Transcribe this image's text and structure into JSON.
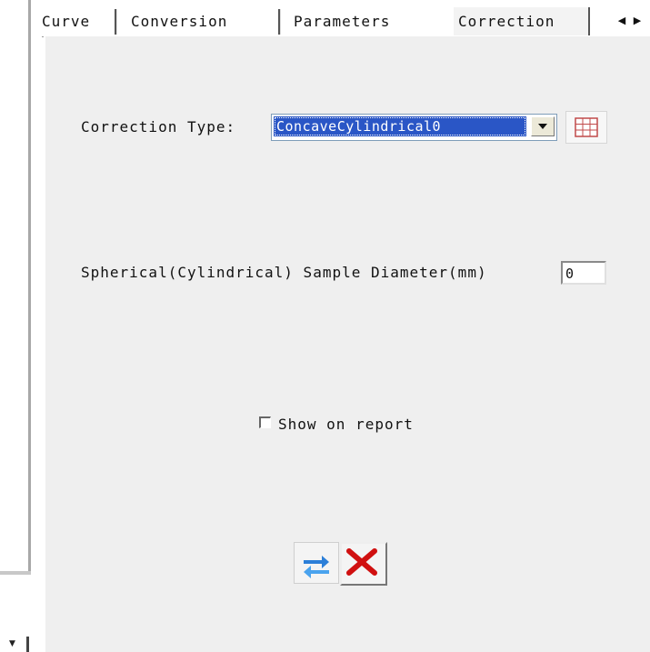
{
  "tabs": [
    {
      "label": "Curve",
      "active": false
    },
    {
      "label": "Conversion",
      "active": false
    },
    {
      "label": "Parameters",
      "active": false
    },
    {
      "label": "Correction",
      "active": true
    }
  ],
  "tab_scroll": {
    "left_icon": "tab-scroll-left-icon",
    "right_icon": "tab-scroll-right-icon"
  },
  "correction_type": {
    "label": "Correction Type:",
    "selected_value": "ConcaveCylindrical0"
  },
  "sample_diameter": {
    "label": "Spherical(Cylindrical) Sample Diameter(mm)",
    "value": "0"
  },
  "show_on_report": {
    "label": "Show on report",
    "checked": false
  },
  "actions": {
    "apply_icon": "refresh-icon",
    "cancel_icon": "close-icon"
  },
  "colors": {
    "selection": "#2a56c6",
    "panel": "#efefef",
    "cancel_red": "#d01010",
    "refresh_blue": "#2c7fd8"
  }
}
